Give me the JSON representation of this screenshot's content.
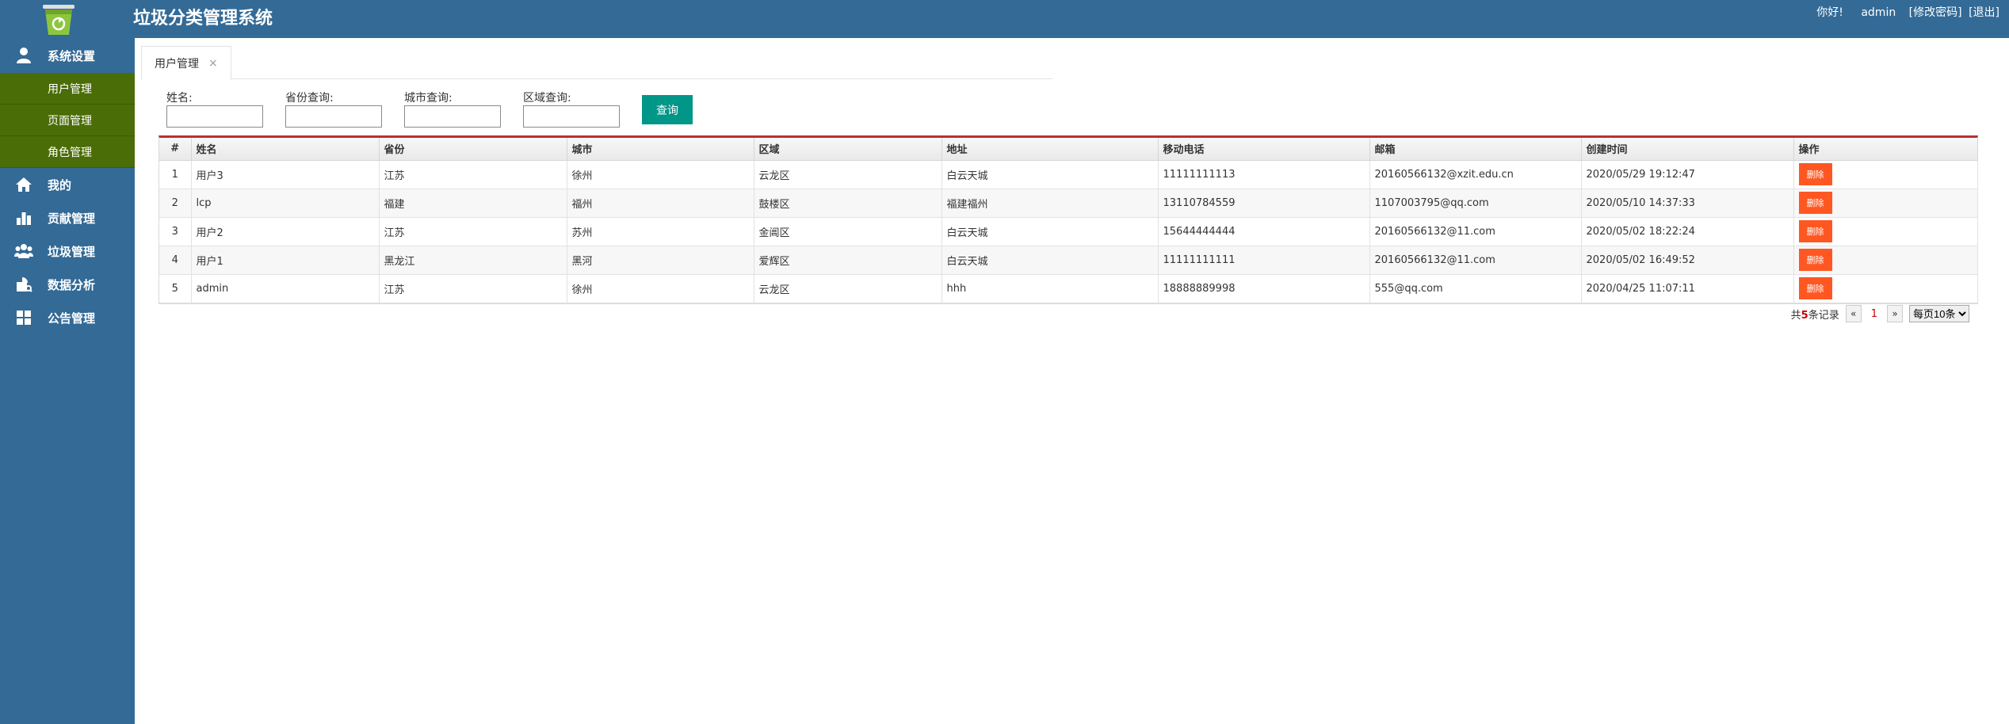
{
  "header": {
    "title": "垃圾分类管理系统",
    "greeting": "你好!",
    "username": "admin",
    "change_password": "[修改密码]",
    "logout": "[退出]"
  },
  "sidebar": {
    "items": [
      {
        "label": "系统设置",
        "icon": "user-icon"
      },
      {
        "label": "用户管理"
      },
      {
        "label": "页面管理"
      },
      {
        "label": "角色管理"
      },
      {
        "label": "我的",
        "icon": "home-icon"
      },
      {
        "label": "贡献管理",
        "icon": "bar-chart-icon"
      },
      {
        "label": "垃圾管理",
        "icon": "group-icon"
      },
      {
        "label": "数据分析",
        "icon": "analysis-icon"
      },
      {
        "label": "公告管理",
        "icon": "grid-icon"
      }
    ]
  },
  "tabs": [
    {
      "label": "用户管理",
      "close": "×"
    }
  ],
  "search": {
    "name_label": "姓名:",
    "province_label": "省份查询:",
    "city_label": "城市查询:",
    "district_label": "区域查询:",
    "name_value": "",
    "province_value": "",
    "city_value": "",
    "district_value": "",
    "query_button": "查询"
  },
  "table": {
    "headers": [
      "#",
      "姓名",
      "省份",
      "城市",
      "区域",
      "地址",
      "移动电话",
      "邮箱",
      "创建时间",
      "操作"
    ],
    "delete_label": "删除",
    "rows": [
      [
        "1",
        "用户3",
        "江苏",
        "徐州",
        "云龙区",
        "白云天城",
        "11111111113",
        "20160566132@xzit.edu.cn",
        "2020/05/29 19:12:47"
      ],
      [
        "2",
        "lcp",
        "福建",
        "福州",
        "鼓楼区",
        "福建福州",
        "13110784559",
        "1107003795@qq.com",
        "2020/05/10 14:37:33"
      ],
      [
        "3",
        "用户2",
        "江苏",
        "苏州",
        "金阊区",
        "白云天城",
        "15644444444",
        "20160566132@11.com",
        "2020/05/02 18:22:24"
      ],
      [
        "4",
        "用户1",
        "黑龙江",
        "黑河",
        "爱辉区",
        "白云天城",
        "11111111111",
        "20160566132@11.com",
        "2020/05/02 16:49:52"
      ],
      [
        "5",
        "admin",
        "江苏",
        "徐州",
        "云龙区",
        "hhh",
        "18888889998",
        "555@qq.com",
        "2020/04/25 11:07:11"
      ]
    ]
  },
  "pager": {
    "total_prefix": "共",
    "total_count": "5",
    "total_suffix": "条记录",
    "prev": "«",
    "current": "1",
    "next": "»",
    "page_size": "每页10条"
  },
  "colors": {
    "header_bg": "#336a96",
    "submenu_bg": "#4b6d07",
    "query_button": "#009688",
    "delete_button": "#ff5722",
    "table_top_border": "#b93131"
  }
}
